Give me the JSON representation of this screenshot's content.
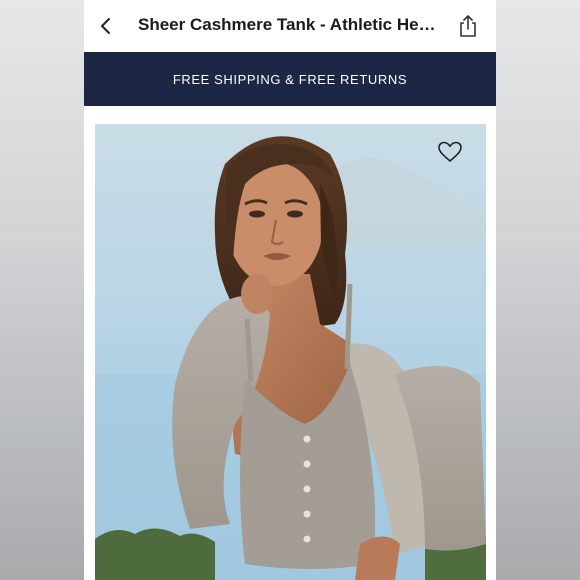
{
  "header": {
    "title": "Sheer Cashmere Tank - Athletic Heather"
  },
  "banner": {
    "text": "FREE SHIPPING & FREE RETURNS"
  },
  "product_image": {
    "description_icon": "product-photo"
  },
  "icons": {
    "back": "chevron-left-icon",
    "share": "share-icon",
    "favorite": "heart-icon"
  },
  "colors": {
    "banner_bg": "#1c2645",
    "banner_text": "#ffffff",
    "title_text": "#1b1b1b"
  }
}
